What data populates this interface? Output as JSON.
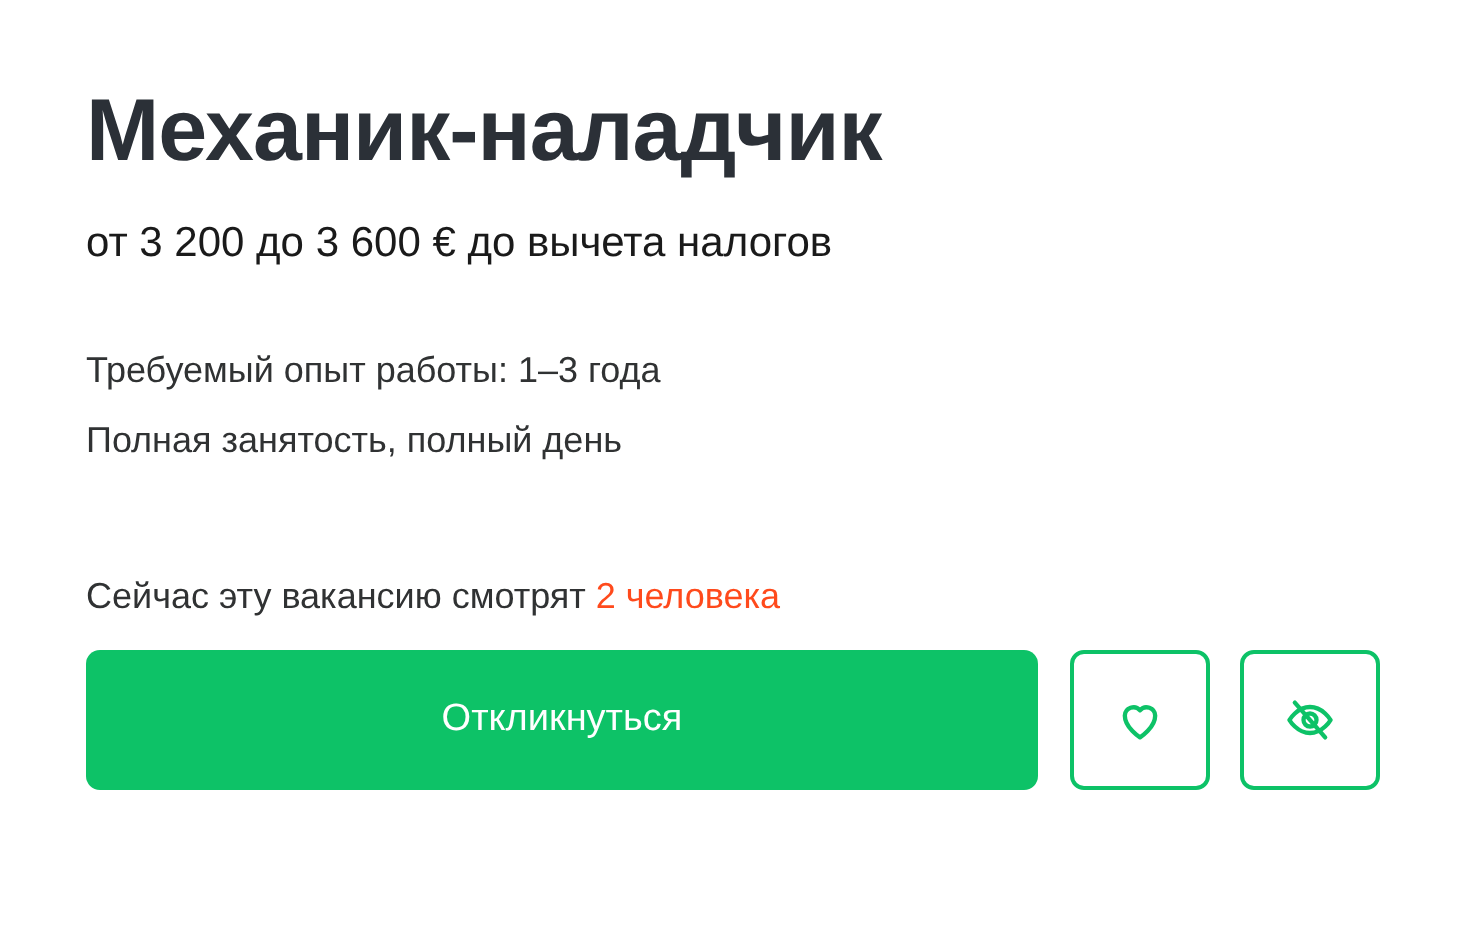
{
  "title": "Механик-наладчик",
  "salary": "от 3 200 до 3 600 € до вычета налогов",
  "details": [
    "Требуемый опыт работы: 1–3 года",
    "Полная занятость, полный день"
  ],
  "viewers": {
    "text": "Сейчас эту вакансию смотрят",
    "count": "2 человека"
  },
  "apply_button": {
    "label": "Откликнуться"
  },
  "actions": [
    {
      "kind": "favorite"
    },
    {
      "kind": "hide"
    }
  ]
}
